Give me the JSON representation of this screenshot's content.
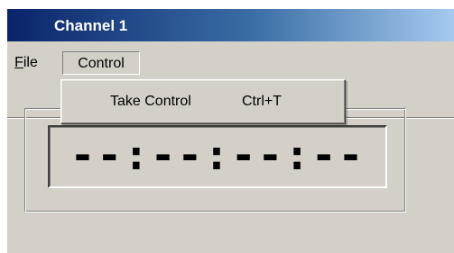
{
  "window": {
    "title": "Channel 1"
  },
  "menubar": {
    "file_mnemonic": "F",
    "file_rest": "ile",
    "control_label": "Control"
  },
  "control_menu": {
    "items": [
      {
        "label": "Take Control",
        "shortcut": "Ctrl+T"
      }
    ]
  },
  "display": {
    "time_text": "--:--:--:--"
  },
  "colors": {
    "titlebar_start": "#0a246a",
    "titlebar_end": "#a6caf0",
    "face": "#d4d0c8",
    "title_text": "#ffffff"
  }
}
